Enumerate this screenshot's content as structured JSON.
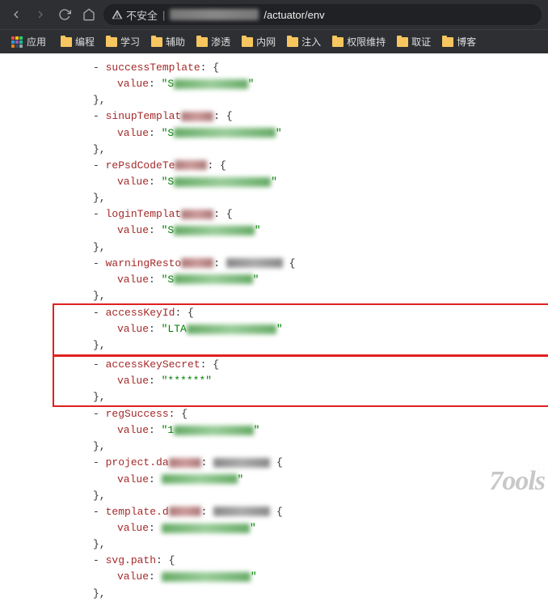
{
  "chrome": {
    "insecure_label": "不安全",
    "url_path": "/actuator/env"
  },
  "bookmarks": {
    "apps_label": "应用",
    "items": [
      "编程",
      "学习",
      "辅助",
      "渗透",
      "内网",
      "注入",
      "权限维持",
      "取证",
      "博客"
    ]
  },
  "json": {
    "entries": [
      {
        "key": "successTemplate",
        "value_prefix": "\"S",
        "value_clear": ""
      },
      {
        "key": "sinupTemplat",
        "value_prefix": "\"S",
        "value_clear": ""
      },
      {
        "key": "rePsdCodeTe",
        "value_prefix": "\"S",
        "value_clear": ""
      },
      {
        "key": "loginTemplat",
        "value_prefix": "\"S",
        "value_clear": ""
      },
      {
        "key": "warningResto",
        "value_prefix": "\"S",
        "value_clear": ""
      },
      {
        "key": "accessKeyId",
        "value_prefix": "\"LTA",
        "value_clear": "",
        "highlight": true
      },
      {
        "key": "accessKeySecret",
        "value_prefix": "",
        "value_clear": "\"******\"",
        "highlight": true
      },
      {
        "key": "regSuccess",
        "value_prefix": "\"1",
        "value_clear": ""
      },
      {
        "key": "project.da",
        "value_prefix": "",
        "value_clear": ""
      },
      {
        "key": "template.d",
        "value_prefix": "",
        "value_clear": ""
      },
      {
        "key": "svg.path",
        "value_prefix": "",
        "value_clear": ""
      }
    ],
    "value_label": "value"
  },
  "watermark": "7ools"
}
